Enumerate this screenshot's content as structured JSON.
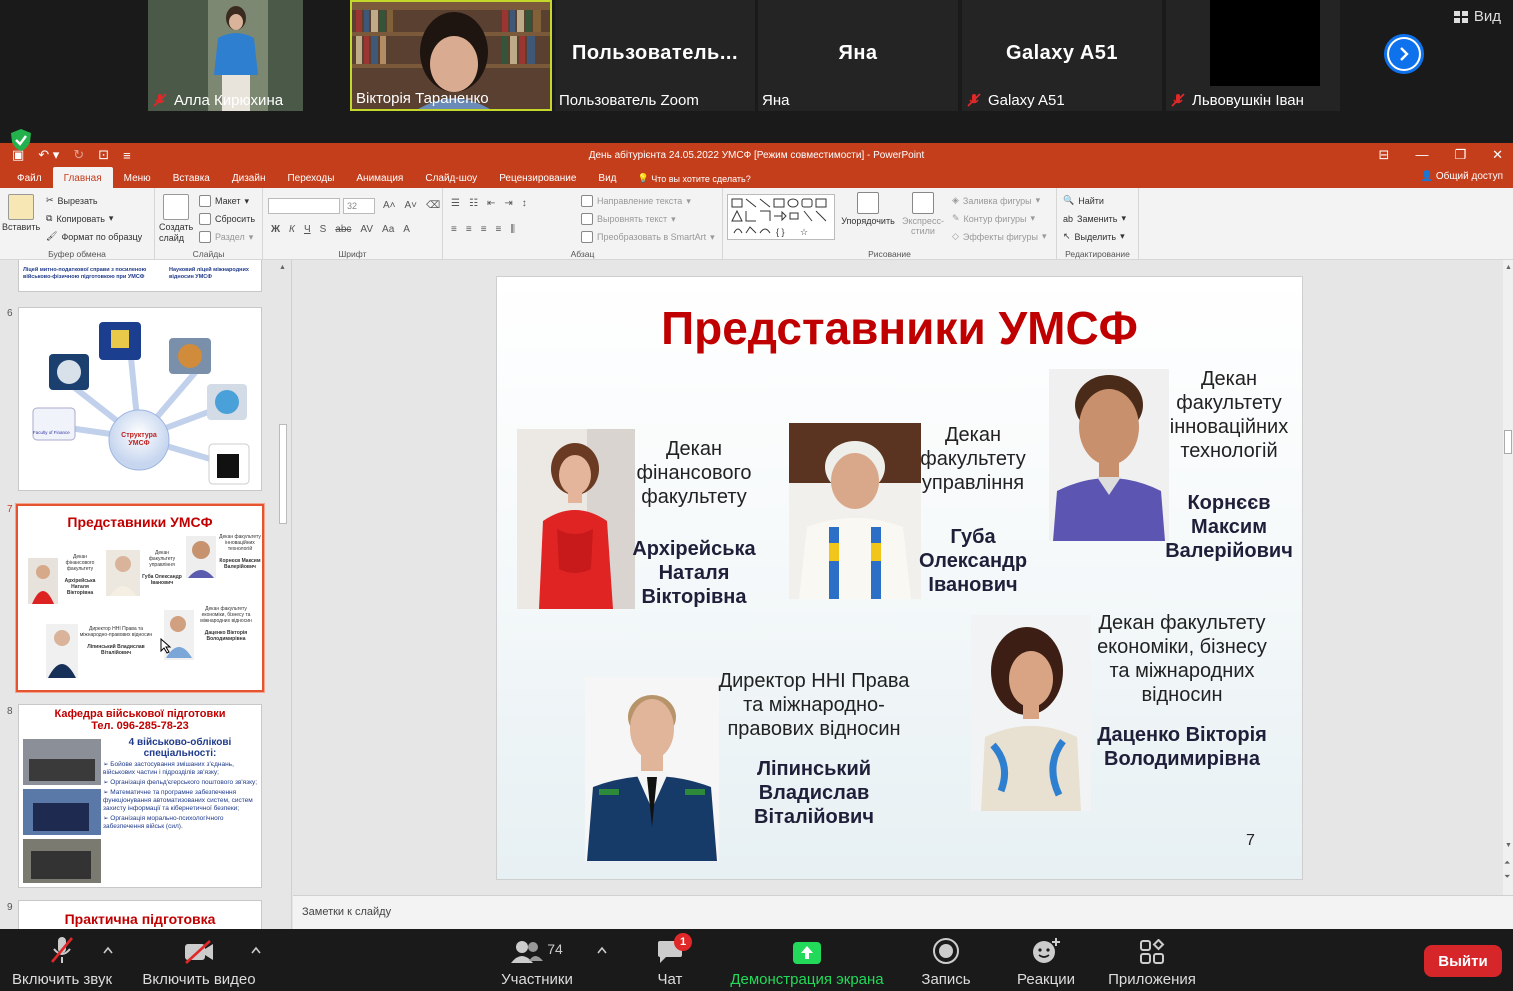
{
  "gallery": {
    "view_label": "Вид",
    "participants": [
      {
        "name": "Алла Кирюхина",
        "muted": true,
        "video": true
      },
      {
        "name": "Вікторія Тараненко",
        "muted": false,
        "video": true,
        "active_speaker": true
      },
      {
        "name": "Пользователь Zoom",
        "big_name": "Пользователь...",
        "muted": false,
        "video": false
      },
      {
        "name": "Яна",
        "big_name": "Яна",
        "muted": false,
        "video": false
      },
      {
        "name": "Galaxy A51",
        "big_name": "Galaxy A51",
        "muted": true,
        "video": false
      },
      {
        "name": "Львовушкін Іван",
        "muted": true,
        "video": true
      }
    ]
  },
  "ppt": {
    "title": "День абітурієнта 24.05.2022 УМСФ [Режим совместимости] - PowerPoint",
    "tabs": [
      "Файл",
      "Главная",
      "Меню",
      "Вставка",
      "Дизайн",
      "Переходы",
      "Анимация",
      "Слайд-шоу",
      "Рецензирование",
      "Вид"
    ],
    "active_tab": "Главная",
    "tell_me": "Что вы хотите сделать?",
    "share": "Общий доступ",
    "ribbon": {
      "clipboard": {
        "paste": "Вставить",
        "cut": "Вырезать",
        "copy": "Копировать",
        "format_painter": "Формат по образцу",
        "label": "Буфер обмена"
      },
      "slides": {
        "new_slide": "Создать слайд",
        "layout": "Макет",
        "reset": "Сбросить",
        "section": "Раздел",
        "label": "Слайды"
      },
      "font": {
        "size": "32",
        "label": "Шрифт"
      },
      "paragraph": {
        "text_direction": "Направление текста",
        "align_text": "Выровнять текст",
        "smartart": "Преобразовать в SmartArt",
        "label": "Абзац"
      },
      "drawing": {
        "arrange": "Упорядочить",
        "quick_styles": "Экспресс-стили",
        "fill": "Заливка фигуры",
        "outline": "Контур фигуры",
        "effects": "Эффекты фигуры",
        "label": "Рисование"
      },
      "editing": {
        "find": "Найти",
        "replace": "Заменить",
        "select": "Выделить",
        "label": "Редактирование"
      }
    },
    "thumbnails": {
      "partial_top_text_a": "Ліцей митно-податкової справи з посиленою військово-фізичною підготовкою при УМСФ",
      "partial_top_text_b": "Науковий ліцей міжнародних відносин УМСФ",
      "slide6": {
        "number": "6",
        "center_label": "Структура УМСФ",
        "faculty_label": "Faculty of Finance"
      },
      "slide7": {
        "number": "7",
        "title": "Представники УМСФ"
      },
      "slide8": {
        "number": "8",
        "title": "Кафедра військової підготовки",
        "phone": "Тел. 096-285-78-23",
        "subtitle": "4 військово-облікові спеціальності:",
        "items": [
          "Бойове застосування змішаних з'єднань, військових частин і підрозділів зв'язку;",
          "Організація фельд'єгерського поштового зв'язку;",
          "Математичне та програмне забезпечення функціонування автоматизованих систем, систем захисту інформації та кібернетичної безпеки;",
          "Організація морально-психологічного забезпечення військ (сил)."
        ]
      },
      "slide9": {
        "number": "9",
        "title": "Практична підготовка"
      }
    },
    "slide": {
      "title": "Представники УМСФ",
      "number": "7",
      "people": [
        {
          "role": "Декан фінансового факультету",
          "name": "Архірейська Наталя Вікторівна"
        },
        {
          "role": "Декан факультету управління",
          "name": "Губа Олександр Іванович"
        },
        {
          "role": "Декан факультету інноваційних технологій",
          "name": "Корнєєв Максим Валерійович"
        },
        {
          "role": "Директор ННІ Права та міжнародно-правових відносин",
          "name": "Ліпинський Владислав Віталійович"
        },
        {
          "role": "Декан факультету економіки, бізнесу та міжнародних відносин",
          "name": "Даценко Вікторія Володимирівна"
        }
      ]
    },
    "notes_placeholder": "Заметки к слайду"
  },
  "toolbar": {
    "unmute": "Включить звук",
    "start_video": "Включить видео",
    "participants": "Участники",
    "participants_count": "74",
    "chat": "Чат",
    "chat_badge": "1",
    "share_screen": "Демонстрация экрана",
    "record": "Запись",
    "reactions": "Реакции",
    "apps": "Приложения",
    "leave": "Выйти"
  },
  "colors": {
    "ppt_accent": "#c43e1c",
    "slide_title": "#c00000",
    "zoom_green": "#23d959",
    "leave_red": "#d6262a",
    "zoom_blue": "#0e72ed"
  }
}
